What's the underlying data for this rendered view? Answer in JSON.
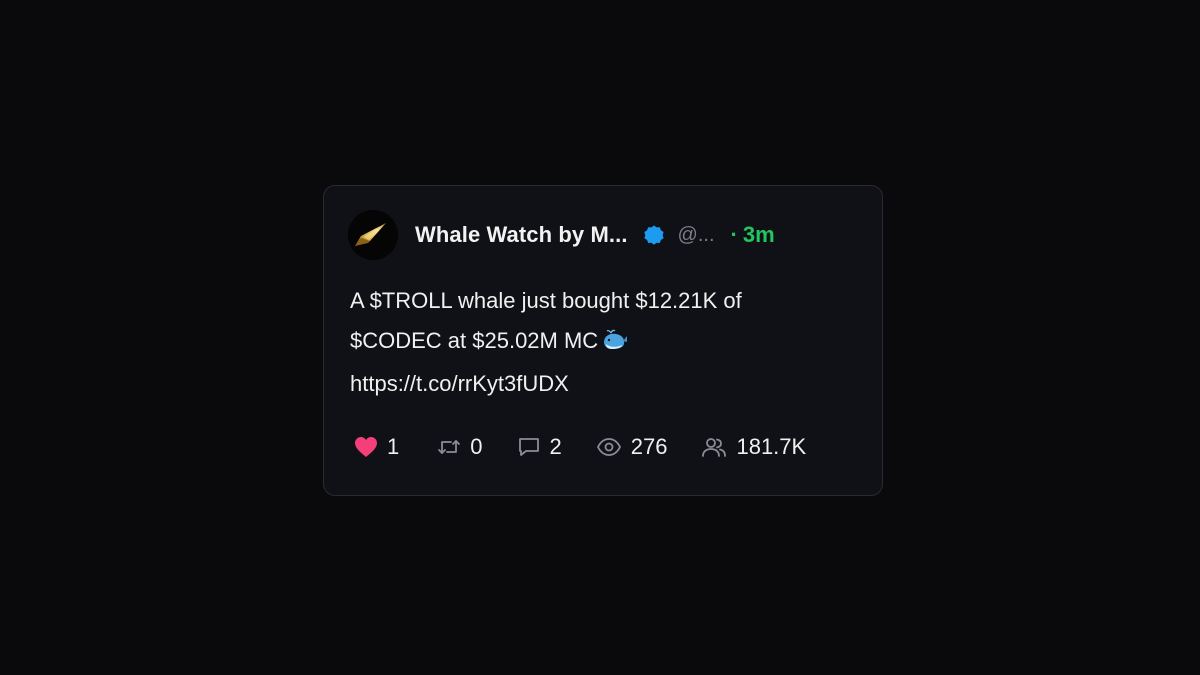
{
  "post": {
    "author_name": "Whale Watch by M...",
    "handle": "@...",
    "time_dot": "·",
    "time": "3m",
    "verified": true,
    "text_line1": "A $TROLL whale just bought $12.21K of",
    "text_line2": "$CODEC at $25.02M MC",
    "text_emoji": "whale-emoji",
    "link": "https://t.co/rrKyt3fUDX"
  },
  "stats": {
    "likes": "1",
    "reposts": "0",
    "replies": "2",
    "views": "276",
    "followers": "181.7K"
  },
  "colors": {
    "background": "#0a0a0c",
    "card": "#101116",
    "time_accent": "#22c55e",
    "verified_badge": "#1d9bf0",
    "heart": "#f43f7a",
    "icon_muted": "#8b8d95"
  },
  "icons": {
    "avatar": "gold-arrow-avatar",
    "verified": "verified-badge-icon",
    "likes": "heart-icon",
    "reposts": "repost-icon",
    "replies": "comment-icon",
    "views": "eye-icon",
    "followers": "users-icon"
  }
}
